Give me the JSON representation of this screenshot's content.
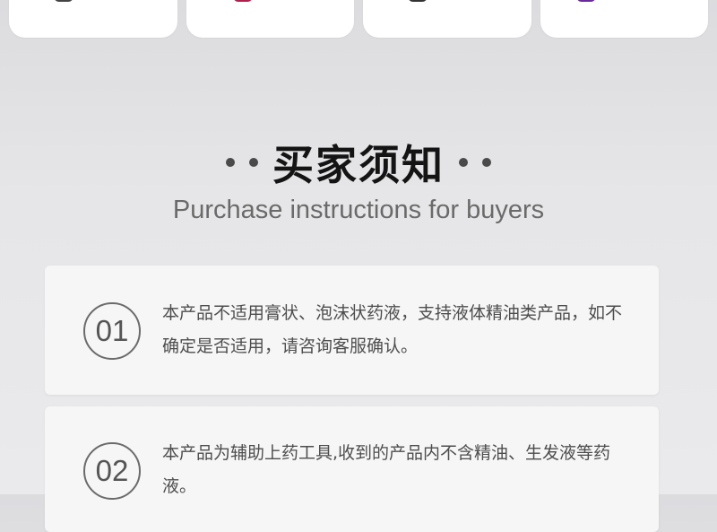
{
  "swatches": [
    {
      "color": "#444444"
    },
    {
      "color": "#b0204a"
    },
    {
      "color": "#333333"
    },
    {
      "color": "#6a2a9a"
    }
  ],
  "header": {
    "title": "买家须知",
    "subtitle": "Purchase instructions for buyers"
  },
  "notices": [
    {
      "number": "01",
      "text": "本产品不适用膏状、泡沫状药液，支持液体精油类产品，如不确定是否适用，请咨询客服确认。"
    },
    {
      "number": "02",
      "text": "本产品为辅助上药工具,收到的产品内不含精油、生发液等药液。"
    }
  ]
}
